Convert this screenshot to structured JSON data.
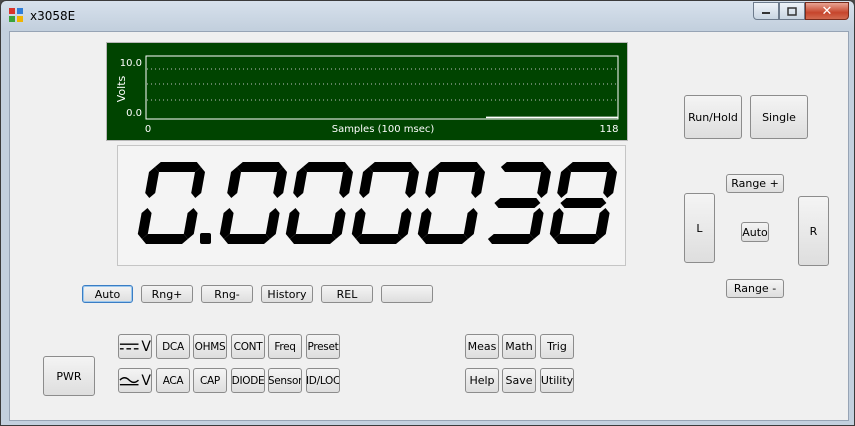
{
  "window": {
    "title": "x3058E"
  },
  "chart_data": {
    "type": "line",
    "ylabel": "Volts",
    "xlabel": "Samples (100 msec)",
    "yticks": [
      "10.0",
      "0.0"
    ],
    "xticks": [
      "0",
      "118"
    ],
    "xlim": [
      0,
      118
    ],
    "ylim": [
      0,
      10
    ],
    "grid": "dotted horizontal",
    "series": [
      {
        "points": [
          [
            85,
            0.1
          ],
          [
            118,
            0.1
          ]
        ]
      }
    ],
    "colors": {
      "background": "#004400",
      "axis": "#ffffff",
      "grid": "#bfbfbf",
      "trace": "#ffffff"
    }
  },
  "display": {
    "reading": "0.000038"
  },
  "function_row": {
    "auto": "Auto",
    "rng_plus": "Rng+",
    "rng_minus": "Rng-",
    "history": "History",
    "rel": "REL",
    "blank": ""
  },
  "power": {
    "label": "PWR"
  },
  "dc_volts": {
    "symbol": "V",
    "icon": "dc-symbol-icon"
  },
  "ac_volts": {
    "symbol": "V",
    "icon": "ac-symbol-icon"
  },
  "measure_row1": [
    "DCA",
    "OHMS",
    "CONT",
    "Freq",
    "Preset"
  ],
  "measure_row2": [
    "ACA",
    "CAP",
    "DIODE",
    "Sensor",
    "ID/LOC"
  ],
  "right_row1": [
    "Meas",
    "Math",
    "Trig"
  ],
  "right_row2": [
    "Help",
    "Save",
    "Utility"
  ],
  "run_hold": "Run/Hold",
  "single": "Single",
  "range_plus": "Range +",
  "range_minus": "Range -",
  "nav_left": "L",
  "nav_right": "R",
  "nav_auto": "Auto"
}
